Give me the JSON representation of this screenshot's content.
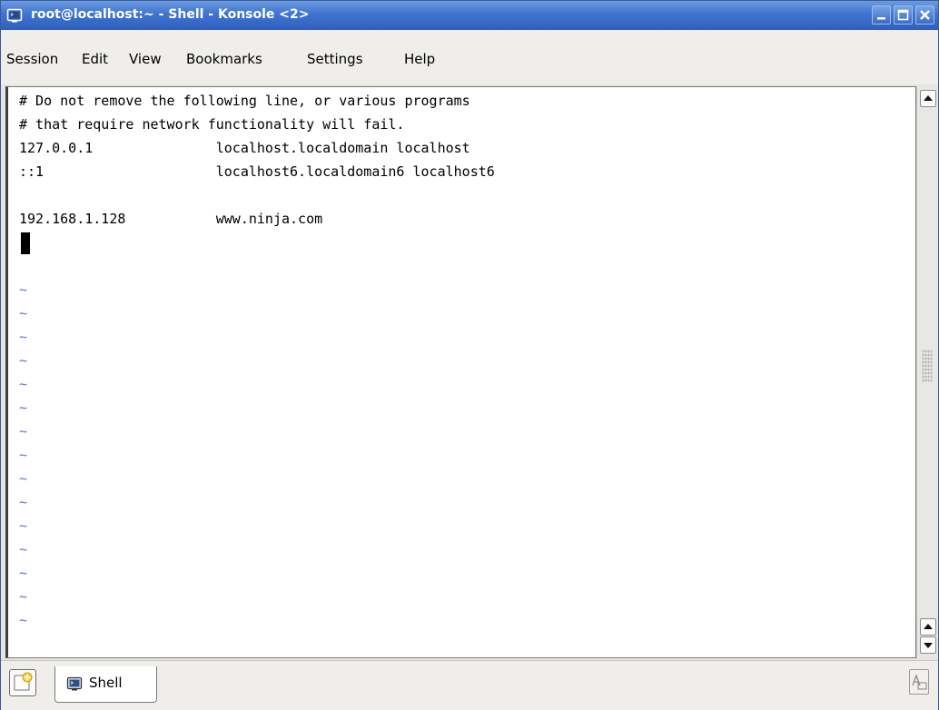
{
  "window": {
    "title": "root@localhost:~ - Shell - Konsole <2>"
  },
  "menu": {
    "items": [
      "Session",
      "Edit",
      "View",
      "Bookmarks",
      "Settings",
      "Help"
    ]
  },
  "terminal": {
    "lines": [
      "# Do not remove the following line, or various programs",
      "# that require network functionality will fail.",
      "127.0.0.1               localhost.localdomain localhost",
      "::1                     localhost6.localdomain6 localhost6",
      "",
      "192.168.1.128           www.ninja.com"
    ],
    "tilde_lines": [
      "~",
      "~",
      "~",
      "~",
      "~",
      "~",
      "~",
      "~",
      "~",
      "~",
      "~",
      "~",
      "~",
      "~",
      "~"
    ]
  },
  "tabs": {
    "items": [
      {
        "label": "Shell",
        "icon": "konsole-terminal-icon"
      }
    ]
  },
  "colors": {
    "titlebar": "#3f74cf",
    "tilde": "#5a78d0"
  }
}
